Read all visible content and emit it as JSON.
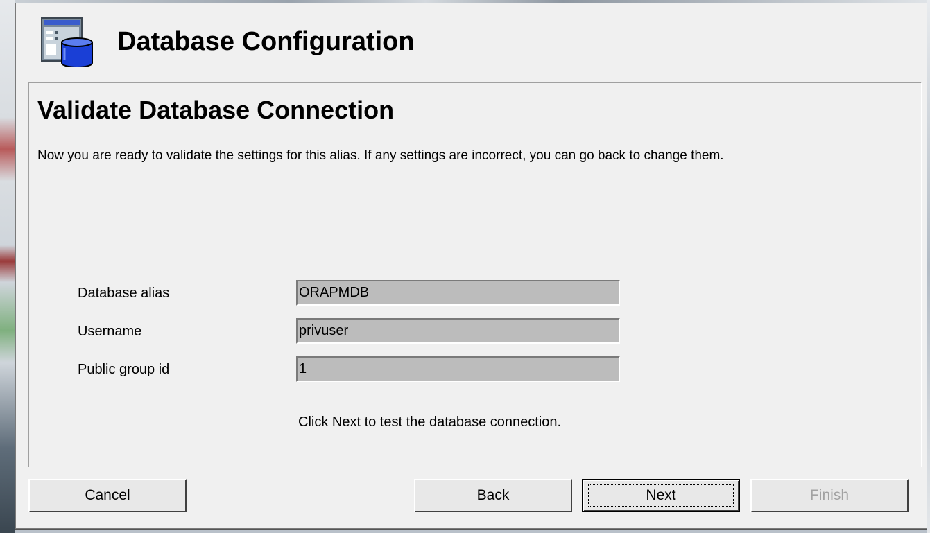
{
  "dialog": {
    "title": "Database Configuration",
    "icon": "database-config-icon"
  },
  "page": {
    "title": "Validate Database Connection",
    "description": "Now you are ready to validate the settings for this alias.  If any settings are incorrect, you can go back to change them."
  },
  "fields": {
    "alias": {
      "label": "Database alias",
      "value": "ORAPMDB"
    },
    "username": {
      "label": "Username",
      "value": "privuser"
    },
    "group": {
      "label": "Public group id",
      "value": "1"
    }
  },
  "hint": "Click Next to test the database connection.",
  "buttons": {
    "cancel": "Cancel",
    "back": "Back",
    "next": "Next",
    "finish": "Finish"
  },
  "colors": {
    "dialog_bg": "#f0f0f0",
    "field_bg": "#bcbcbc",
    "icon_blue": "#1a3fd6",
    "disabled_text": "#a2a2a2"
  }
}
